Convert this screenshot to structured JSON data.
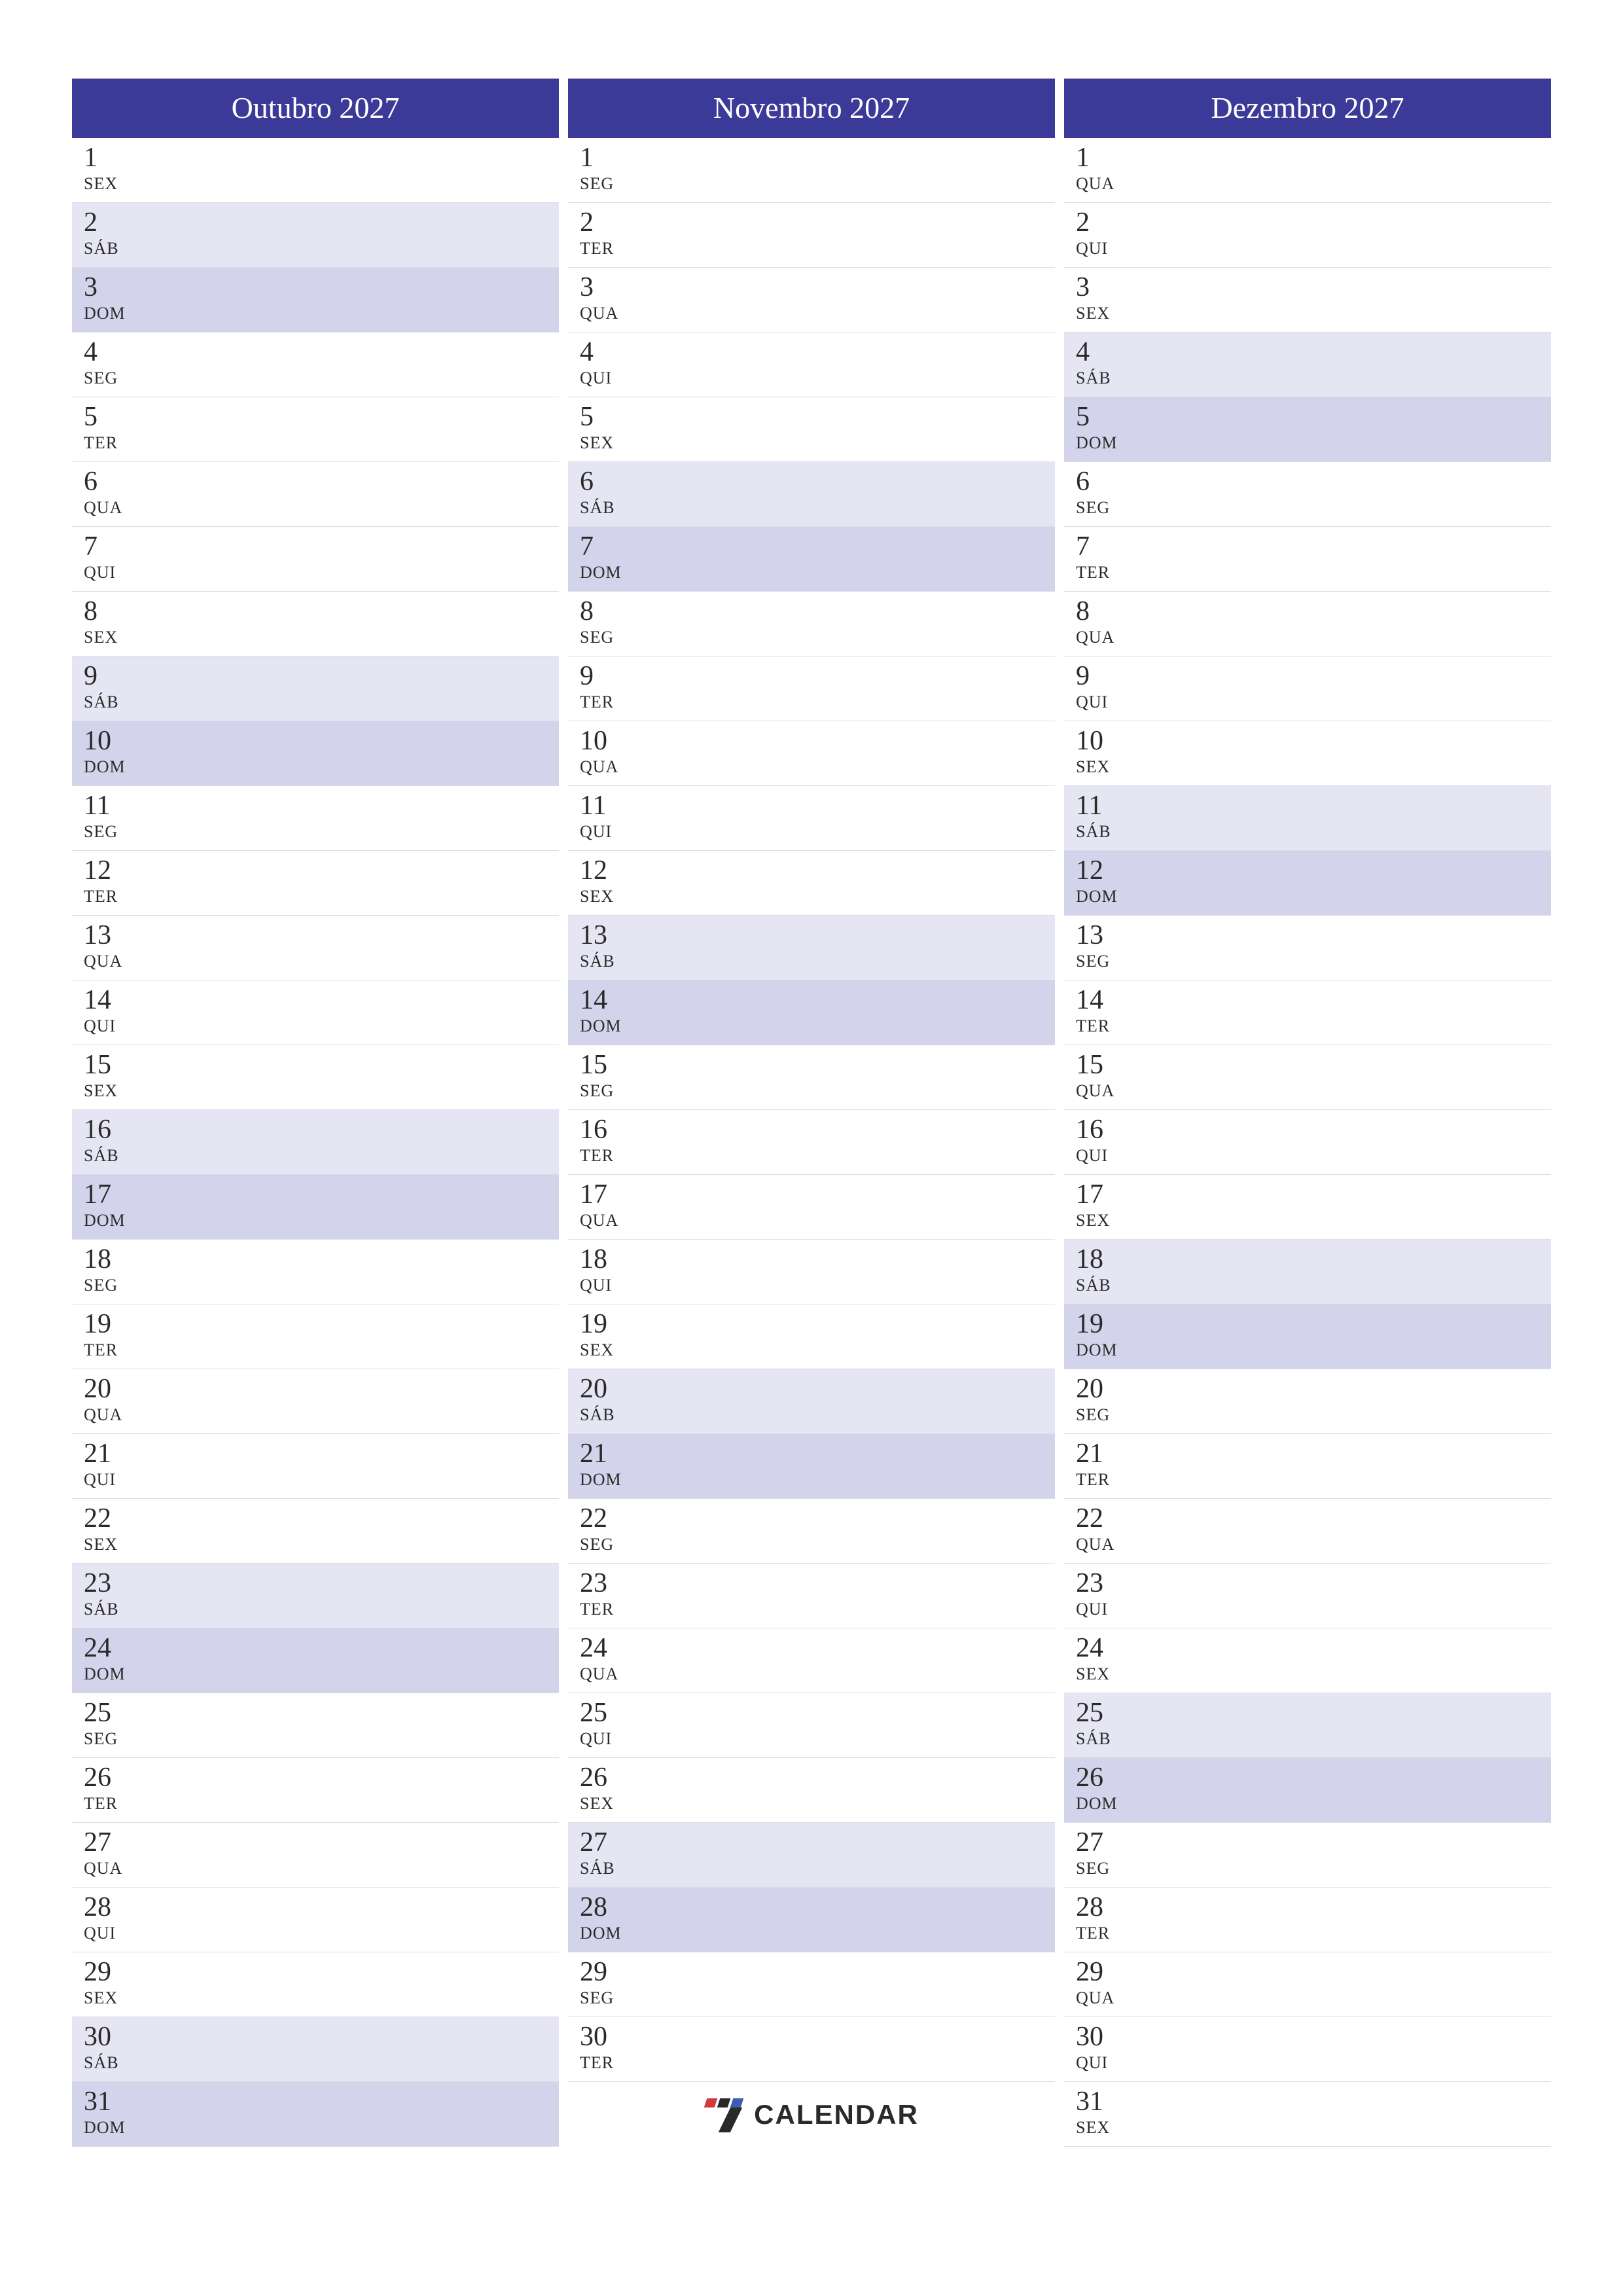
{
  "brand": {
    "name": "CALENDAR"
  },
  "dow_labels": {
    "mon": "SEG",
    "tue": "TER",
    "wed": "QUA",
    "thu": "QUI",
    "fri": "SEX",
    "sat": "SÁB",
    "sun": "DOM"
  },
  "months": [
    {
      "title": "Outubro 2027",
      "start_dow": "fri",
      "num_days": 31,
      "logo_after": null
    },
    {
      "title": "Novembro 2027",
      "start_dow": "mon",
      "num_days": 30,
      "logo_after": true
    },
    {
      "title": "Dezembro 2027",
      "start_dow": "wed",
      "num_days": 31,
      "logo_after": null
    }
  ],
  "colors": {
    "header_bg": "#3b3a98",
    "sat_bg": "#e5e5f4",
    "sun_bg": "#d3d3eb"
  }
}
